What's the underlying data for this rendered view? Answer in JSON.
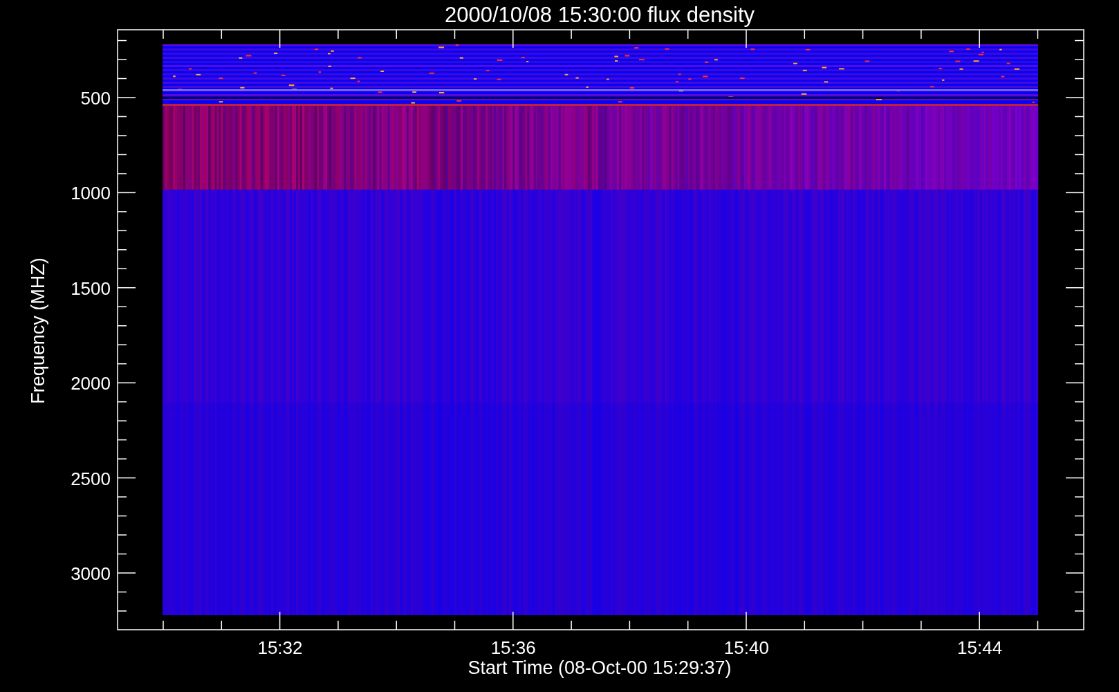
{
  "title": "2000/10/08 15:30:00 flux density",
  "ylabel": "Frequency (MHZ)",
  "xlabel": "Start Time (08-Oct-00 15:29:37)",
  "yticks": [
    "500",
    "1000",
    "1500",
    "2000",
    "2500",
    "3000"
  ],
  "xticks": [
    "15:32",
    "15:36",
    "15:40",
    "15:44"
  ]
}
